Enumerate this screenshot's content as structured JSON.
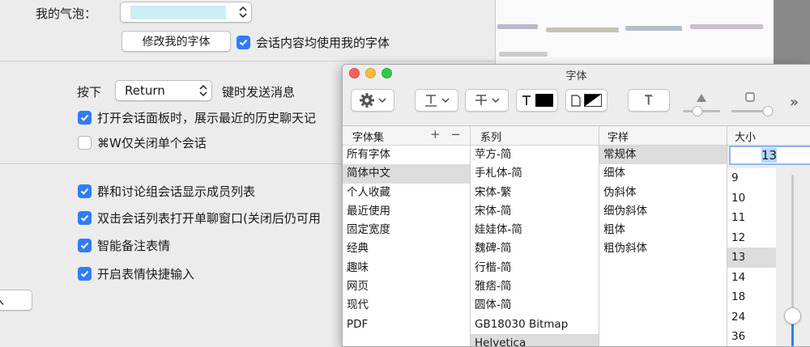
{
  "prefs": {
    "bubble_label": "我的气泡：",
    "modify_font_button": "修改我的字体",
    "use_my_font_label": "会话内容均使用我的字体",
    "press_label": "按下",
    "send_key_value": "Return",
    "send_key_suffix": "键时发送消息",
    "options": [
      {
        "label": "打开会话面板时，展示最近的历史聊天记",
        "checked": true
      },
      {
        "label": "⌘W仅关闭单个会话",
        "checked": false
      }
    ],
    "options2": [
      {
        "label": "群和讨论组会话显示成员列表",
        "checked": true
      },
      {
        "label": "双击会话列表打开单聊窗口(关闭后仍可用",
        "checked": true
      },
      {
        "label": "智能备注表情",
        "checked": true
      },
      {
        "label": "开启表情快捷输入",
        "checked": true
      }
    ],
    "partial_button": "入"
  },
  "font_panel": {
    "title": "字体",
    "headers": {
      "collections": "字体集",
      "family": "系列",
      "typeface": "字样",
      "size": "大小"
    },
    "add_remove": "+ −",
    "collections": [
      "所有字体",
      "简体中文",
      "个人收藏",
      "最近使用",
      "固定宽度",
      "经典",
      "趣味",
      "网页",
      "现代",
      "PDF"
    ],
    "collections_selected": 1,
    "families": [
      "苹方-简",
      "手札体-简",
      "宋体-繁",
      "宋体-简",
      "娃娃体-简",
      "魏碑-简",
      "行楷-简",
      "雅痞-简",
      "圆体-简",
      "GB18030 Bitmap",
      "Helvetica"
    ],
    "families_selected": 10,
    "typefaces": [
      "常规体",
      "细体",
      "伪斜体",
      "细伪斜体",
      "粗体",
      "粗伪斜体"
    ],
    "typefaces_selected": 0,
    "size_value": "13",
    "sizes": [
      "9",
      "10",
      "11",
      "12",
      "13",
      "14",
      "18",
      "24",
      "36"
    ],
    "sizes_selected": 4,
    "toolbar_more": "»"
  },
  "colors": {
    "accent": "#2f7df6",
    "close": "#fc605c",
    "minimize": "#fdbc40",
    "zoom": "#34c84a"
  }
}
